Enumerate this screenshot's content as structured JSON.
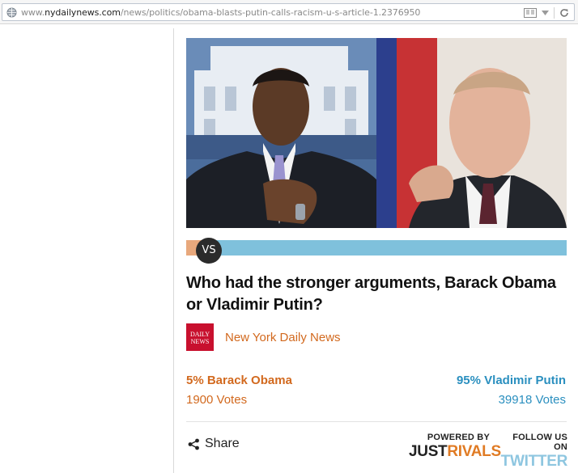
{
  "browser": {
    "url_prefix": "www.",
    "url_domain": "nydailynews.com",
    "url_path": "/news/politics/obama-blasts-putin-calls-racism-u-s-article-1.2376950"
  },
  "poll": {
    "vs_label": "VS",
    "question": "Who had the stronger arguments, Barack Obama or Vladimir Putin?",
    "source": {
      "logo_line1": "DAILY",
      "logo_line2": "NEWS",
      "name": "New York Daily News"
    },
    "left": {
      "pct_text": "5% Barack Obama",
      "votes_text": "1900 Votes",
      "share": 0.05,
      "color": "#d2691e"
    },
    "right": {
      "pct_text": "95% Vladimir Putin",
      "votes_text": "39918 Votes",
      "share": 0.95,
      "color": "#2a8fbf"
    }
  },
  "footer": {
    "share_label": "Share",
    "powered_by": "POWERED BY",
    "brand_part1": "JUST",
    "brand_part2": "RIVALS",
    "follow_us": "FOLLOW US ON",
    "twitter": "TWITTER"
  }
}
